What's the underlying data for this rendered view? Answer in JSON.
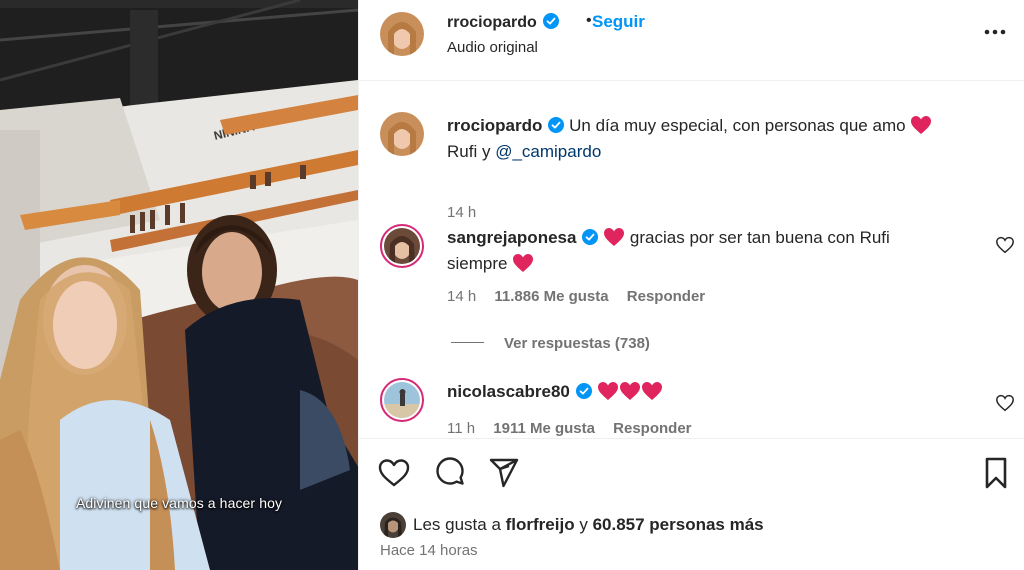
{
  "video": {
    "caption": "Adivinen que vamos a hacer hoy",
    "sign_text": "NININA"
  },
  "header": {
    "username": "rrociopardo",
    "separator": "•",
    "follow_label": "Seguir",
    "audio_label": "Audio original"
  },
  "post": {
    "username": "rrociopardo",
    "text_before": "Un día muy especial, con personas que amo",
    "text_line2": "Rufi y",
    "mention": "@_camipardo",
    "time": "14 h"
  },
  "comments": [
    {
      "username": "sangrejaponesa",
      "text": "gracias por ser tan buena con Rufi",
      "text_line2": "siempre",
      "time": "14 h",
      "likes": "11.886 Me gusta",
      "reply_label": "Responder",
      "replies_label": "Ver respuestas (738)"
    },
    {
      "username": "nicolascabre80",
      "time": "11 h",
      "likes": "1911 Me gusta",
      "reply_label": "Responder"
    }
  ],
  "footer": {
    "likes_prefix": "Les gusta a",
    "likes_user": "florfreijo",
    "likes_connector": "y",
    "likes_count": "60.857 personas más",
    "timestamp": "Hace 14 horas"
  },
  "icons": [
    "heart-icon",
    "comment-icon",
    "share-icon",
    "bookmark-icon",
    "more-icon",
    "verified-icon"
  ],
  "colors": {
    "accent": "#0095f6",
    "mention": "#00376b",
    "muted": "#737373",
    "heart": "#e0245e"
  }
}
